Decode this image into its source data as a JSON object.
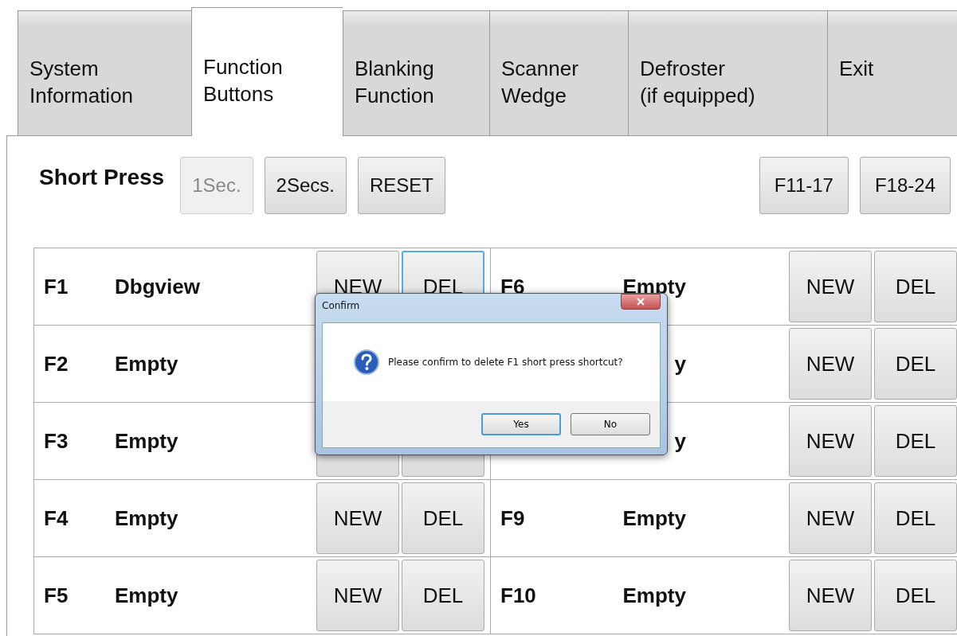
{
  "tabs": [
    {
      "label": "System\nInformation",
      "selected": false
    },
    {
      "label": "Function\nButtons",
      "selected": true
    },
    {
      "label": "Blanking\nFunction",
      "selected": false
    },
    {
      "label": "Scanner\nWedge",
      "selected": false
    },
    {
      "label": "Defroster\n(if equipped)",
      "selected": false
    },
    {
      "label": "Exit",
      "selected": false
    }
  ],
  "mode_label": "Short Press",
  "mode_buttons": [
    {
      "label": "1Sec.",
      "disabled": true
    },
    {
      "label": "2Secs.",
      "disabled": false
    },
    {
      "label": "RESET",
      "disabled": false
    }
  ],
  "page_buttons": [
    "F11-17",
    "F18-24"
  ],
  "left_rows": [
    {
      "key": "F1",
      "label": "Dbgview",
      "new": "NEW",
      "del": "DEL",
      "focused": true
    },
    {
      "key": "F2",
      "label": "Empty"
    },
    {
      "key": "F3",
      "label": "Empty"
    },
    {
      "key": "F4",
      "label": "Empty",
      "new": "NEW",
      "del": "DEL",
      "focused": false
    },
    {
      "key": "F5",
      "label": "Empty",
      "new": "NEW",
      "del": "DEL",
      "focused": false
    }
  ],
  "right_rows": [
    {
      "key": "F6",
      "label": "Empty",
      "new": "NEW",
      "del": "DEL",
      "focused": false
    },
    {
      "label": "y",
      "new": "NEW",
      "del": "DEL",
      "focused": false
    },
    {
      "label": "y",
      "new": "NEW",
      "del": "DEL",
      "focused": false
    },
    {
      "key": "F9",
      "label": "Empty",
      "new": "NEW",
      "del": "DEL",
      "focused": false
    },
    {
      "key": "F10",
      "label": "Empty",
      "new": "NEW",
      "del": "DEL",
      "focused": false
    }
  ],
  "dialog": {
    "title": "Confirm",
    "message": "Please confirm to delete F1 short press shortcut?",
    "buttons": [
      {
        "label": "Yes",
        "default": true
      },
      {
        "label": "No",
        "default": false
      }
    ]
  }
}
